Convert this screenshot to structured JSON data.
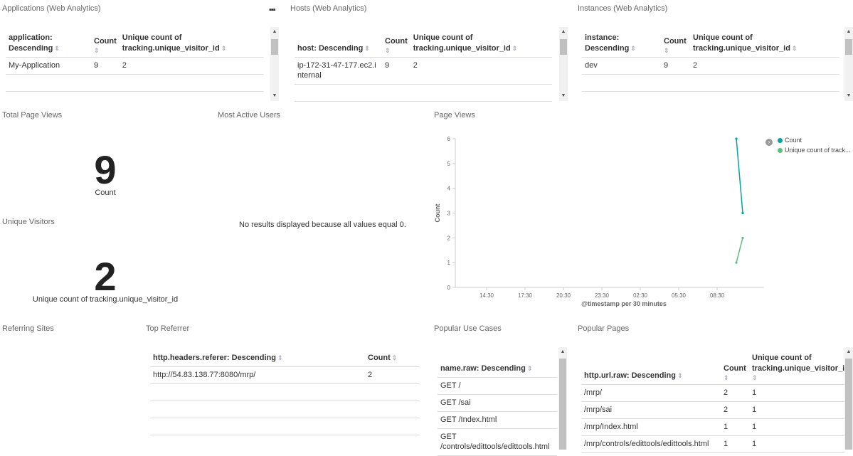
{
  "panels": {
    "applications": {
      "title": "Applications (Web Analytics)",
      "headers": [
        "application: Descending",
        "Count",
        "Unique count of tracking.unique_visitor_id"
      ],
      "rows": [
        [
          "My-Application",
          "9",
          "2"
        ]
      ]
    },
    "hosts": {
      "title": "Hosts (Web Analytics)",
      "headers": [
        "host: Descending",
        "Count",
        "Unique count of tracking.unique_visitor_id"
      ],
      "rows": [
        [
          "ip-172-31-47-177.ec2.internal",
          "9",
          "2"
        ]
      ]
    },
    "instances": {
      "title": "Instances (Web Analytics)",
      "headers": [
        "instance: Descending",
        "Count",
        "Unique count of tracking.unique_visitor_id"
      ],
      "rows": [
        [
          "dev",
          "9",
          "2"
        ]
      ]
    },
    "total_page_views": {
      "title": "Total Page Views",
      "value": "9",
      "label": "Count"
    },
    "most_active_users": {
      "title": "Most Active Users",
      "message": "No results displayed because all values equal 0."
    },
    "unique_visitors": {
      "title": "Unique Visitors",
      "value": "2",
      "label": "Unique count of tracking.unique_visitor_id"
    },
    "page_views": {
      "title": "Page Views"
    },
    "referring_sites": {
      "title": "Referring Sites"
    },
    "top_referrer": {
      "title": "Top Referrer",
      "headers": [
        "http.headers.referer: Descending",
        "Count"
      ],
      "rows": [
        [
          "http://54.83.138.77:8080/mrp/",
          "2"
        ]
      ]
    },
    "popular_use_cases": {
      "title": "Popular Use Cases",
      "header": "name.raw: Descending",
      "rows": [
        "GET /",
        "GET /sai",
        "GET /Index.html",
        "GET /controls/edittools/edittools.html"
      ]
    },
    "popular_pages": {
      "title": "Popular Pages",
      "headers": [
        "http.url.raw: Descending",
        "Count",
        "Unique count of tracking.unique_visitor_i"
      ],
      "rows": [
        [
          "/mrp/",
          "2",
          "1"
        ],
        [
          "/mrp/sai",
          "2",
          "1"
        ],
        [
          "/mrp/Index.html",
          "1",
          "1"
        ],
        [
          "/mrp/controls/edittools/edittools.html",
          "1",
          "1"
        ]
      ]
    }
  },
  "icons": {
    "menu": "ellipsis-icon",
    "sort": "sort-icon",
    "legend_toggle": "chevron-right-icon"
  },
  "chart_data": {
    "type": "line",
    "xlabel": "@timestamp per 30 minutes",
    "ylabel": "Count",
    "x_ticks": [
      "14:30",
      "17:30",
      "20:30",
      "23:30",
      "02:30",
      "05:30",
      "08:30"
    ],
    "ylim": [
      0,
      6
    ],
    "y_ticks": [
      "0",
      "1",
      "2",
      "3",
      "4",
      "5",
      "6"
    ],
    "legend_position": "right",
    "series": [
      {
        "name": "Count",
        "color": "#00a69b",
        "points": [
          [
            "10:00",
            6
          ],
          [
            "10:30",
            3
          ]
        ]
      },
      {
        "name": "Unique count of track...",
        "color": "#57c17b",
        "points": [
          [
            "10:00",
            1
          ],
          [
            "10:30",
            2
          ]
        ]
      }
    ]
  }
}
